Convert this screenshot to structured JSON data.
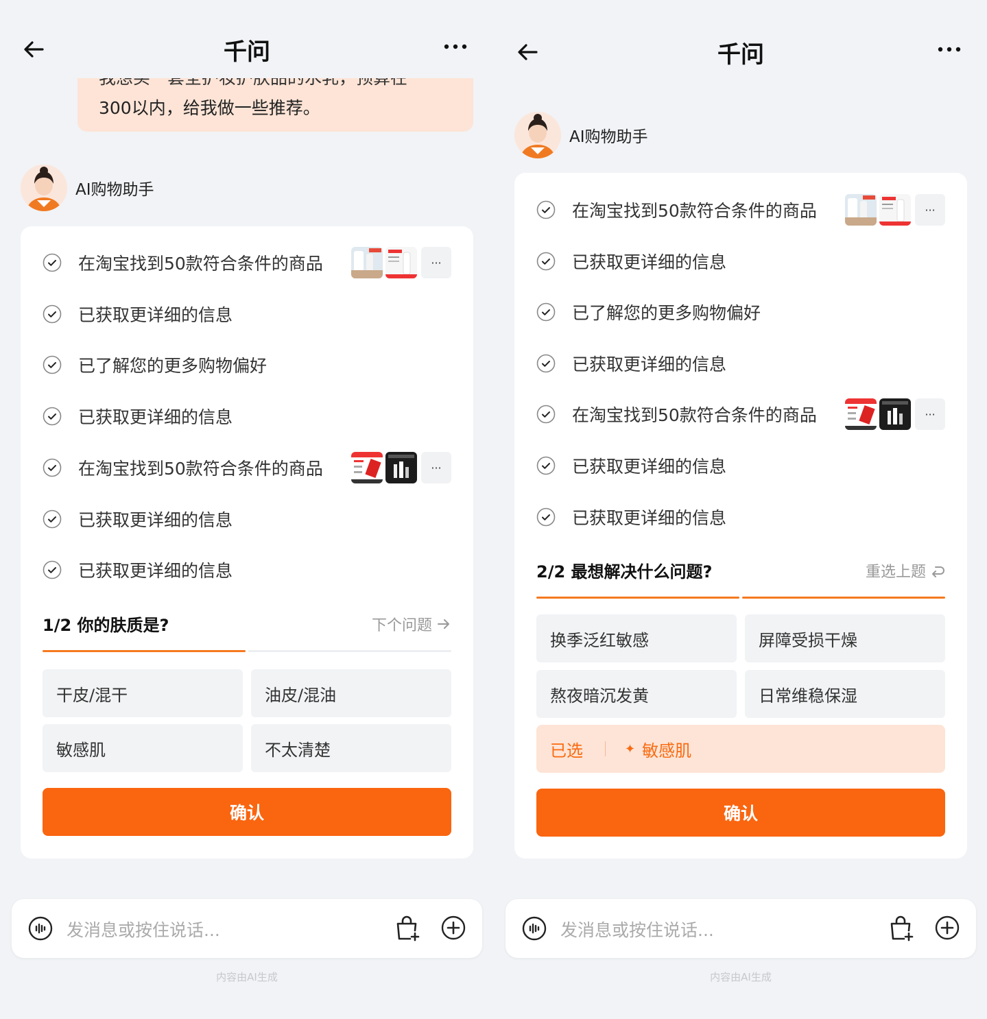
{
  "colors": {
    "accent": "#fa650f",
    "bubble": "#fde4d6",
    "option_bg": "#f1f3f5"
  },
  "app": {
    "title": "千问"
  },
  "user_message": {
    "partial_line": "我想买一套全护妆护肤品的水乳，预算在",
    "line2": "300以内，给我做一些推荐。"
  },
  "assistant": {
    "name": "AI购物助手",
    "avatar_icon": "woman-avatar-icon"
  },
  "steps": [
    {
      "label": "在淘宝找到50款符合条件的商品",
      "thumbs": [
        "product-thumb-white-bottles",
        "product-thumb-red-box"
      ]
    },
    {
      "label": "已获取更详细的信息"
    },
    {
      "label": "已了解您的更多购物偏好"
    },
    {
      "label": "已获取更详细的信息"
    },
    {
      "label": "在淘宝找到50款符合条件的商品",
      "thumbs": [
        "product-thumb-red-white",
        "product-thumb-dark"
      ]
    },
    {
      "label": "已获取更详细的信息"
    },
    {
      "label": "已获取更详细的信息"
    }
  ],
  "thumb_more": "···",
  "question1": {
    "title": "1/2 你的肤质是?",
    "nav": "下个问题",
    "progress_current": 1,
    "progress_total": 2,
    "options": [
      "干皮/混干",
      "油皮/混油",
      "敏感肌",
      "不太清楚"
    ],
    "confirm": "确认"
  },
  "question2": {
    "title": "2/2 最想解决什么问题?",
    "nav": "重选上题",
    "progress_current": 2,
    "progress_total": 2,
    "options": [
      "换季泛红敏感",
      "屏障受损干燥",
      "熬夜暗沉发黄",
      "日常维稳保湿"
    ],
    "selected_label": "已选",
    "selected_value": "敏感肌",
    "confirm": "确认"
  },
  "input": {
    "placeholder": "发消息或按住说话..."
  },
  "footer": "内容由AI生成"
}
